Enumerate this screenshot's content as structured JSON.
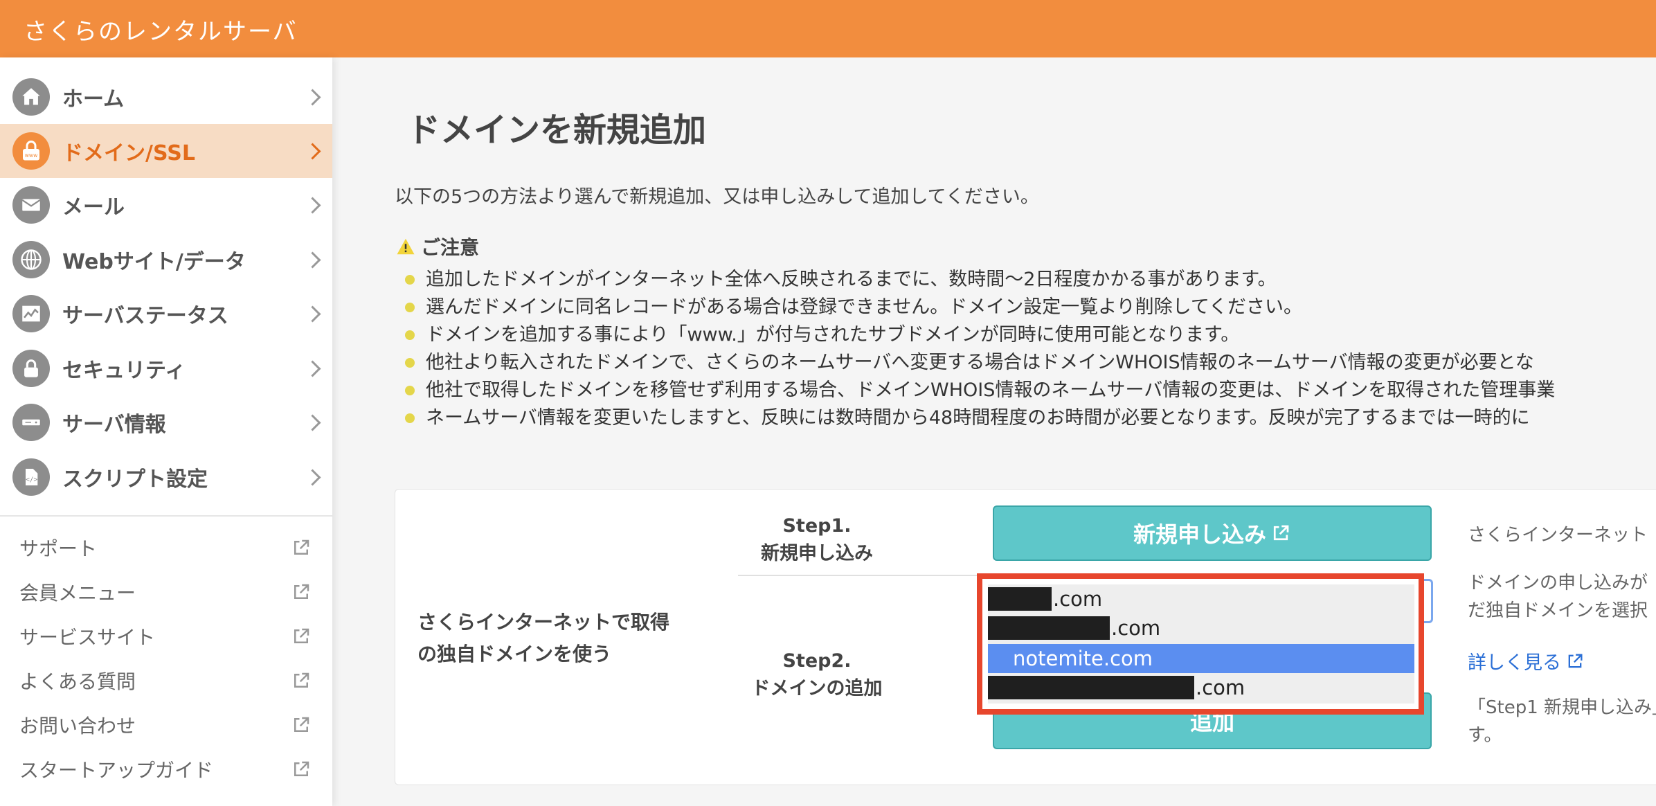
{
  "header": {
    "brand": "さくらのレンタルサーバ"
  },
  "sidebar": {
    "nav": [
      {
        "label": "ホーム",
        "icon": "home-icon"
      },
      {
        "label": "ドメイン/SSL",
        "icon": "domain-lock-icon",
        "active": true
      },
      {
        "label": "メール",
        "icon": "mail-icon"
      },
      {
        "label": "Webサイト/データ",
        "icon": "globe-icon"
      },
      {
        "label": "サーバステータス",
        "icon": "chart-icon"
      },
      {
        "label": "セキュリティ",
        "icon": "lock-icon"
      },
      {
        "label": "サーバ情報",
        "icon": "server-icon"
      },
      {
        "label": "スクリプト設定",
        "icon": "script-file-icon"
      }
    ],
    "links": [
      {
        "label": "サポート"
      },
      {
        "label": "会員メニュー"
      },
      {
        "label": "サービスサイト"
      },
      {
        "label": "よくある質問"
      },
      {
        "label": "お問い合わせ"
      },
      {
        "label": "スタートアップガイド"
      }
    ]
  },
  "main": {
    "title": "ドメインを新規追加",
    "intro": "以下の5つの方法より選んで新規追加、又は申し込みして追加してください。",
    "notice_title": "ご注意",
    "notes": [
      "追加したドメインがインターネット全体へ反映されるまでに、数時間〜2日程度かかる事があります。",
      "選んだドメインに同名レコードがある場合は登録できません。ドメイン設定一覧より削除してください。",
      "ドメインを追加する事により「www.」が付与されたサブドメインが同時に使用可能となります。",
      "他社より転入されたドメインで、さくらのネームサーバへ変更する場合はドメインWHOIS情報のネームサーバ情報の変更が必要とな",
      "他社で取得したドメインを移管せず利用する場合、ドメインWHOIS情報のネームサーバ情報の変更は、ドメインを取得された管理事業",
      "ネームサーバ情報を変更いたしますと、反映には数時間から48時間程度のお時間が必要となります。反映が完了するまでは一時的に"
    ],
    "card": {
      "label_line1": "さくらインターネットで取得",
      "label_line2": "の独自ドメインを使う",
      "step1_title": "Step1.",
      "step1_sub": "新規申し込み",
      "step2_title": "Step2.",
      "step2_sub": "ドメインの追加",
      "apply_button": "新規申し込み",
      "add_button": "追加",
      "options": [
        {
          "suffix": ".com"
        },
        {
          "suffix": ".com"
        },
        {
          "label": "notemite.com",
          "selected": true
        },
        {
          "suffix": ".com"
        }
      ],
      "desc1": "さくらインターネット",
      "desc2_line1": "ドメインの申し込みが",
      "desc2_line2": "だ独自ドメインを選択",
      "more_link": "詳しく見る",
      "desc3_line1": "「Step1 新規申し込み」",
      "desc3_line2": "す。"
    }
  }
}
